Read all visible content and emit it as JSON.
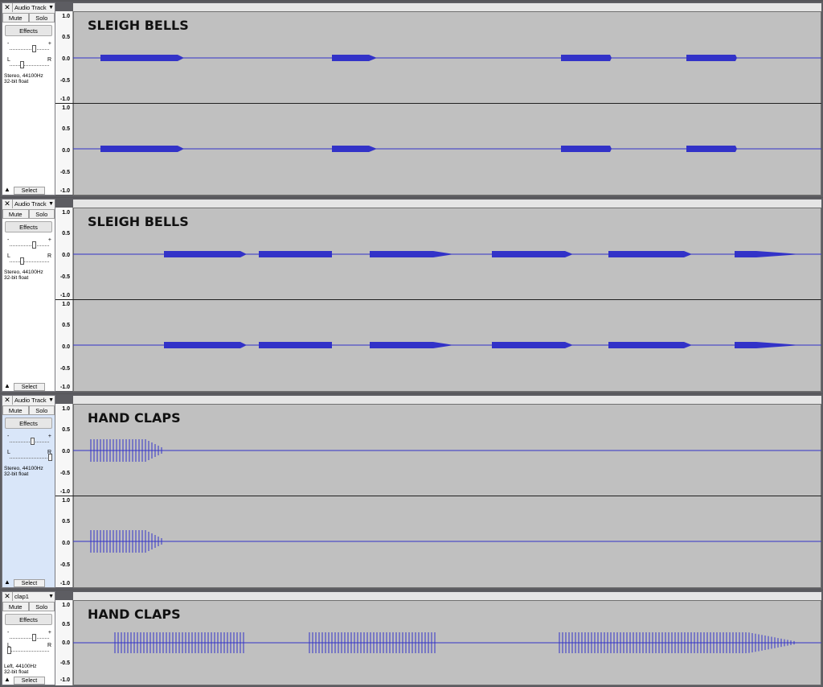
{
  "tracks": [
    {
      "name": "Audio Track",
      "mute_label": "Mute",
      "solo_label": "Solo",
      "effects_label": "Effects",
      "gain_minus": "-",
      "gain_plus": "+",
      "pan_left": "L",
      "pan_right": "R",
      "info_line1": "Stereo, 44100Hz",
      "info_line2": "32-bit float",
      "select_label": "Select",
      "clip_label": "SLEIGH BELLS",
      "ticks": [
        "1.0",
        "0.5",
        "0.0",
        "-0.5",
        "-1.0"
      ],
      "gain_level": 0.5,
      "pan_level": 0.0,
      "channels": 2
    },
    {
      "name": "Audio Track",
      "mute_label": "Mute",
      "solo_label": "Solo",
      "effects_label": "Effects",
      "gain_minus": "-",
      "gain_plus": "+",
      "pan_left": "L",
      "pan_right": "R",
      "info_line1": "Stereo, 44100Hz",
      "info_line2": "32-bit float",
      "select_label": "Select",
      "clip_label": "SLEIGH BELLS",
      "ticks": [
        "1.0",
        "0.5",
        "0.0",
        "-0.5",
        "-1.0"
      ],
      "gain_level": 0.5,
      "pan_level": 0.0,
      "channels": 2
    },
    {
      "name": "Audio Track",
      "mute_label": "Mute",
      "solo_label": "Solo",
      "effects_label": "Effects",
      "gain_minus": "-",
      "gain_plus": "+",
      "pan_left": "L",
      "pan_right": "R",
      "info_line1": "Stereo, 44100Hz",
      "info_line2": "32-bit float",
      "select_label": "Select",
      "clip_label": "HAND CLAPS",
      "ticks": [
        "1.0",
        "0.5",
        "0.0",
        "-0.5",
        "-1.0"
      ],
      "gain_level": 0.45,
      "pan_level": 1.0,
      "channels": 2
    },
    {
      "name": "clap1",
      "mute_label": "Mute",
      "solo_label": "Solo",
      "effects_label": "Effects",
      "gain_minus": "-",
      "gain_plus": "+",
      "pan_left": "L",
      "pan_right": "R",
      "info_line1": "Left, 44100Hz",
      "info_line2": "32-bit float",
      "select_label": "Select",
      "clip_label": "HAND CLAPS",
      "ticks": [
        "1.0",
        "0.5",
        "0.0",
        "-0.5",
        "-1.0"
      ],
      "gain_level": 0.5,
      "pan_level": -1.0,
      "channels": 1
    }
  ],
  "icons": {
    "close": "close-icon",
    "menu": "dropdown-arrow-icon",
    "collapse": "collapse-arrow-icon"
  },
  "colors": {
    "waveform": "#3232c8",
    "wave_bg": "#c0c0c0",
    "panel": "#d9e6f9"
  }
}
